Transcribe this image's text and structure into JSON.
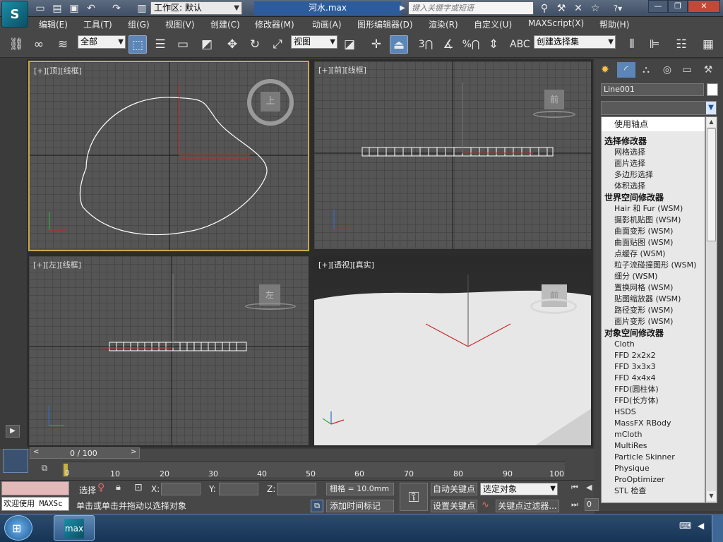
{
  "title_bar": {
    "workspace": "工作区: 默认",
    "document_title": "河水.max",
    "search_placeholder": "键入关键字或短语",
    "app_logo": "max-logo-icon"
  },
  "menu": [
    "编辑(E)",
    "工具(T)",
    "组(G)",
    "视图(V)",
    "创建(C)",
    "修改器(M)",
    "动画(A)",
    "图形编辑器(D)",
    "渲染(R)",
    "自定义(U)",
    "MAXScript(X)",
    "帮助(H)"
  ],
  "toolbar": {
    "selection_filter": "全部",
    "reference_coord": "视图",
    "snap_values": [
      "3",
      "%"
    ],
    "named_selection": "创建选择集"
  },
  "viewports": {
    "top": {
      "label": "[+][顶][线框]",
      "cube": "上"
    },
    "front": {
      "label": "[+][前][线框]",
      "cube": "前"
    },
    "left": {
      "label": "[+][左][线框]",
      "cube": "左"
    },
    "perspective": {
      "label": "[+][透视][真实]",
      "cube": "前"
    }
  },
  "command_panel": {
    "object_name": "Line001",
    "modifier_list": {
      "selected": "使用轴点",
      "groups": [
        {
          "header": "选择修改器",
          "items": [
            "网格选择",
            "面片选择",
            "多边形选择",
            "体积选择"
          ]
        },
        {
          "header": "世界空间修改器",
          "items": [
            "Hair 和 Fur (WSM)",
            "摄影机贴图 (WSM)",
            "曲面变形 (WSM)",
            "曲面贴图 (WSM)",
            "点缓存 (WSM)",
            "粒子流碰撞图形 (WSM)",
            "细分 (WSM)",
            "置换网格 (WSM)",
            "贴图缩放器 (WSM)",
            "路径变形 (WSM)",
            "面片变形 (WSM)"
          ]
        },
        {
          "header": "对象空间修改器",
          "items": [
            "Cloth",
            "FFD 2x2x2",
            "FFD 3x3x3",
            "FFD 4x4x4",
            "FFD(圆柱体)",
            "FFD(长方体)",
            "HSDS",
            "MassFX RBody",
            "mCloth",
            "MultiRes",
            "Particle Skinner",
            "Physique",
            "ProOptimizer",
            "STL 检查"
          ]
        }
      ]
    }
  },
  "timeline": {
    "frame_counter": "0 / 100",
    "ticks": [
      "0",
      "10",
      "20",
      "30",
      "40",
      "50",
      "60",
      "70",
      "80",
      "90",
      "100"
    ]
  },
  "status": {
    "maxscript_listener": "欢迎使用 MAXSc",
    "selection_label": "选择",
    "coord_labels": [
      "X:",
      "Y:",
      "Z:"
    ],
    "grid": "栅格 = 10.0mm",
    "auto_key": "自动关键点",
    "auto_key_target": "选定对象",
    "set_key": "设置关键点",
    "key_filters": "关键点过滤器...",
    "prompt": "单击或单击并拖动以选择对象",
    "add_time_tag": "添加时间标记",
    "frame_field": "0"
  },
  "taskbar": {
    "active_app": "max"
  },
  "colors": {
    "accent": "#2d5c9c",
    "spline": "#ffffff",
    "axis_red": "#cc2b2b"
  }
}
